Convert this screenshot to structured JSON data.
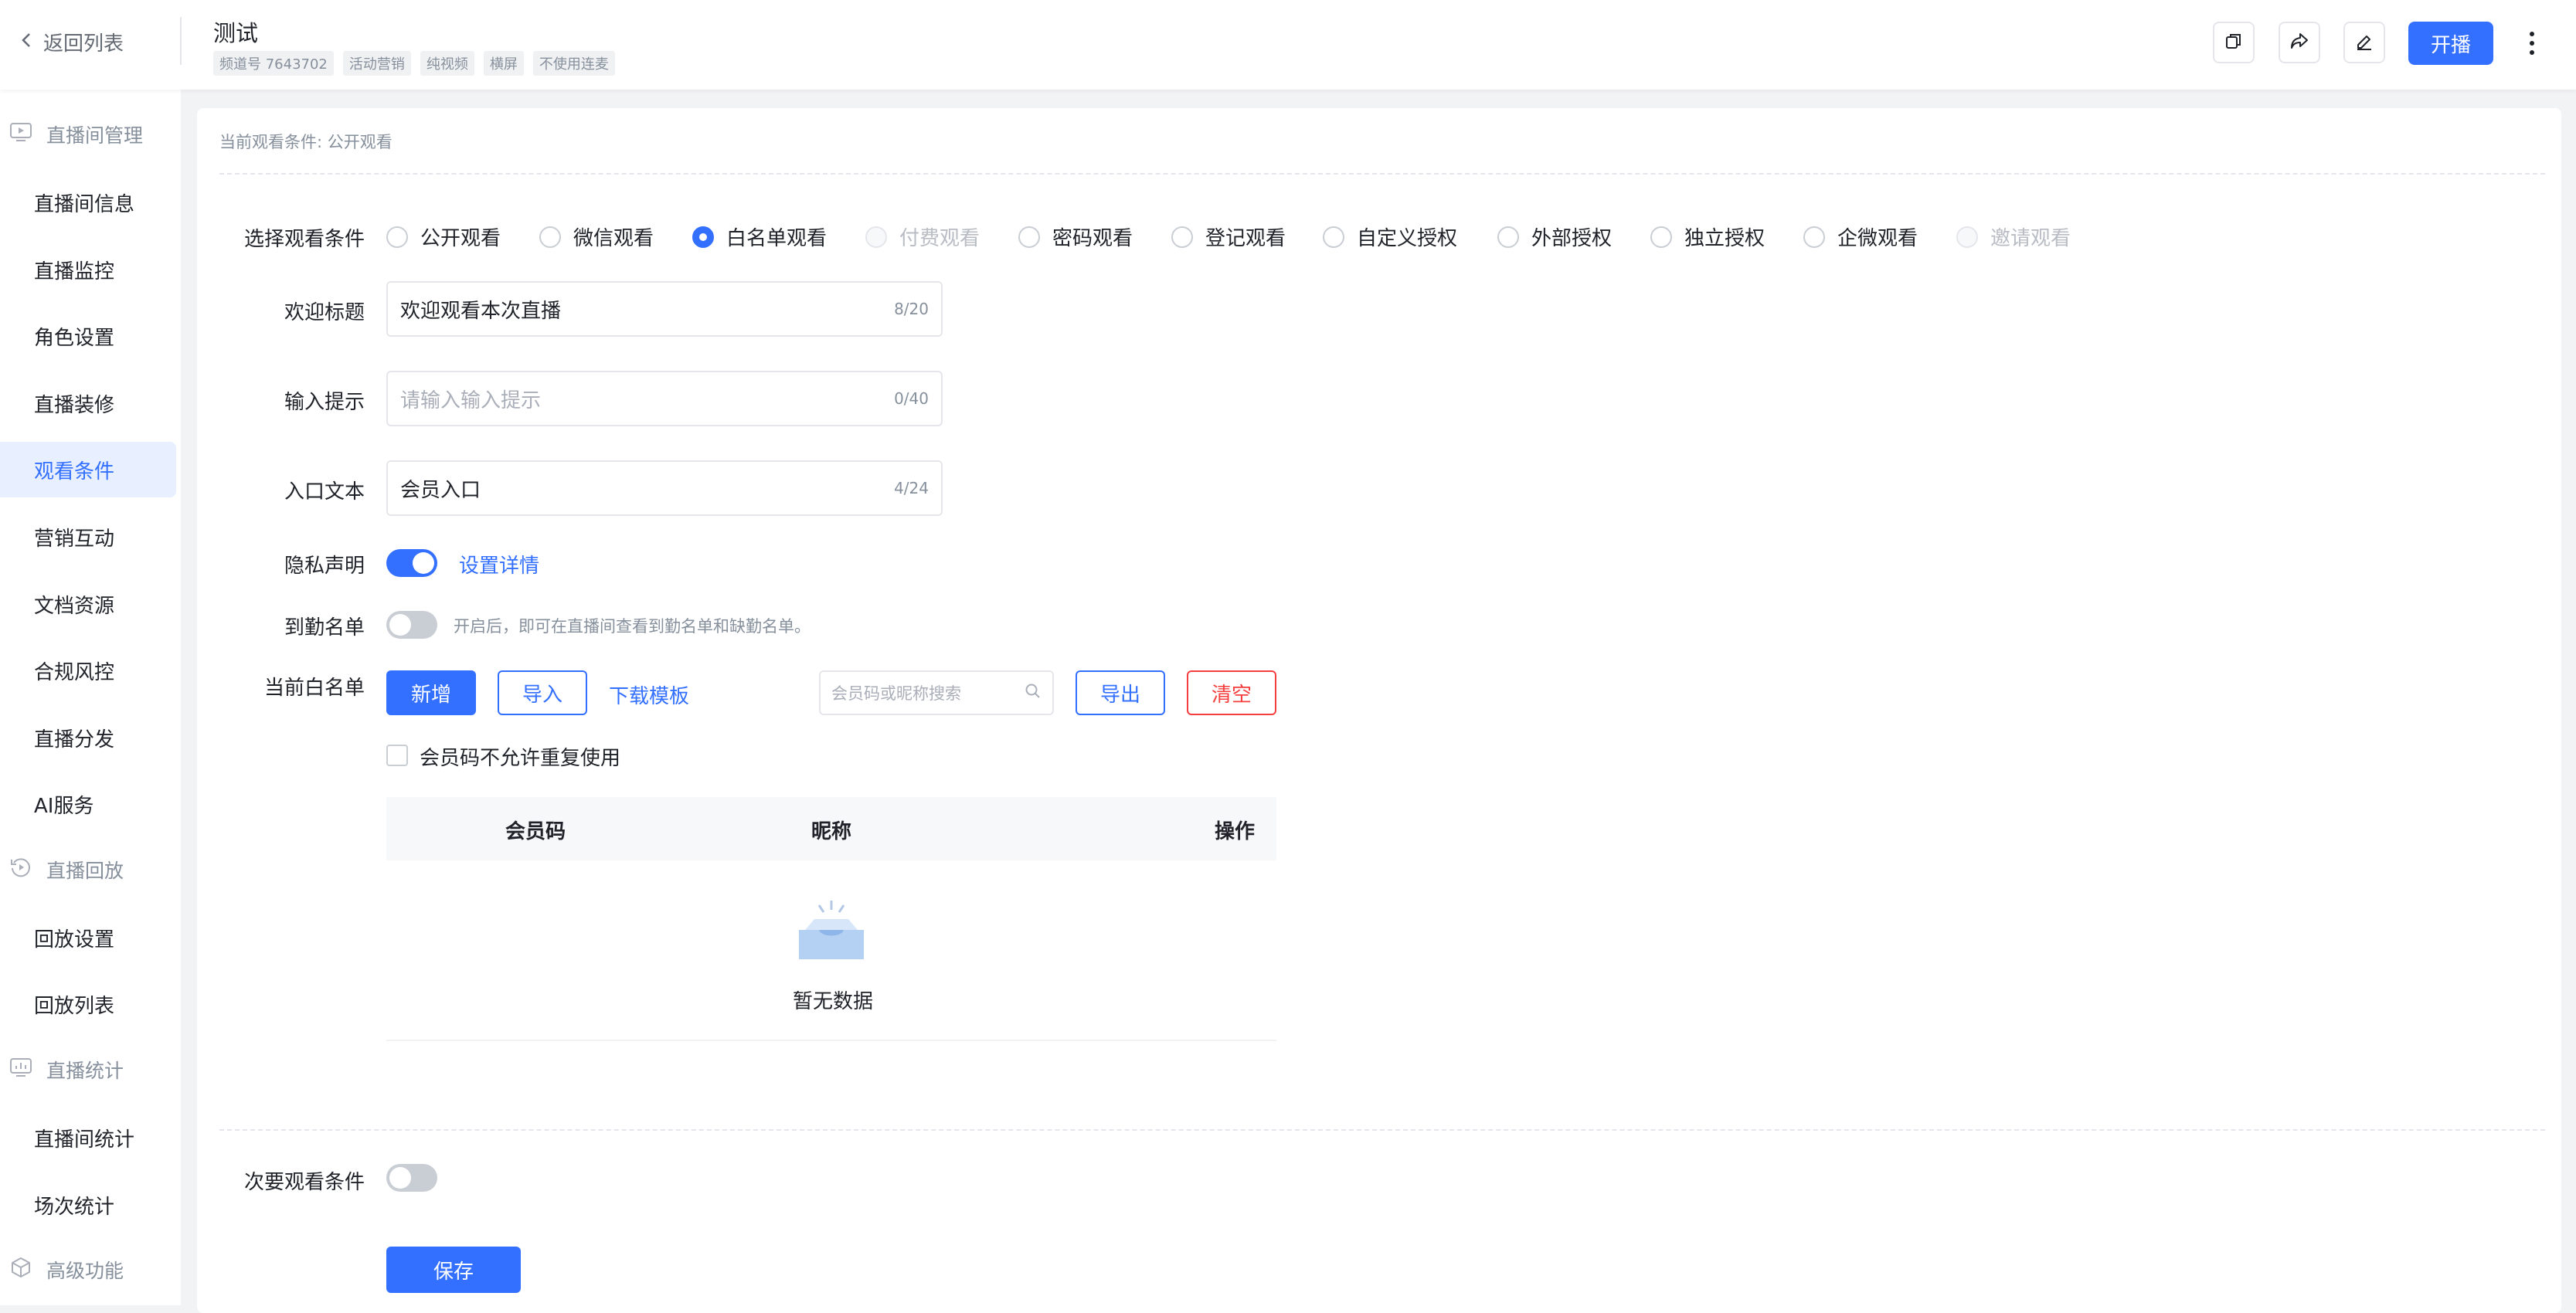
{
  "header": {
    "back_label": "返回列表",
    "title": "测试",
    "tags": [
      "频道号 7643702",
      "活动营销",
      "纯视频",
      "横屏",
      "不使用连麦"
    ],
    "start_button": "开播",
    "icons": [
      "copy-icon",
      "share-icon",
      "edit-icon",
      "more-vertical-icon"
    ]
  },
  "sidebar": {
    "groups": [
      {
        "label": "直播间管理",
        "icon": "monitor-play-icon"
      },
      {
        "label": "直播回放",
        "icon": "replay-icon"
      },
      {
        "label": "直播统计",
        "icon": "stats-icon"
      },
      {
        "label": "高级功能",
        "icon": "box-icon"
      }
    ],
    "items": [
      "直播间信息",
      "直播监控",
      "角色设置",
      "直播装修",
      "观看条件",
      "营销互动",
      "文档资源",
      "合规风控",
      "直播分发",
      "AI服务",
      "回放设置",
      "回放列表",
      "直播间统计",
      "场次统计"
    ],
    "active": "观看条件"
  },
  "main": {
    "current_condition": "当前观看条件: 公开观看",
    "select_label": "选择观看条件",
    "options": [
      {
        "label": "公开观看",
        "state": "normal"
      },
      {
        "label": "微信观看",
        "state": "normal"
      },
      {
        "label": "白名单观看",
        "state": "checked"
      },
      {
        "label": "付费观看",
        "state": "disabled"
      },
      {
        "label": "密码观看",
        "state": "normal"
      },
      {
        "label": "登记观看",
        "state": "normal"
      },
      {
        "label": "自定义授权",
        "state": "normal"
      },
      {
        "label": "外部授权",
        "state": "normal"
      },
      {
        "label": "独立授权",
        "state": "normal"
      },
      {
        "label": "企微观看",
        "state": "normal"
      },
      {
        "label": "邀请观看",
        "state": "disabled"
      }
    ],
    "welcome": {
      "label": "欢迎标题",
      "value": "欢迎观看本次直播",
      "count": "8/20"
    },
    "prompt": {
      "label": "输入提示",
      "placeholder": "请输入输入提示",
      "count": "0/40"
    },
    "entry": {
      "label": "入口文本",
      "value": "会员入口",
      "count": "4/24"
    },
    "privacy": {
      "label": "隐私声明",
      "enabled": true,
      "link": "设置详情"
    },
    "attendance": {
      "label": "到勤名单",
      "enabled": false,
      "hint": "开启后，即可在直播间查看到勤名单和缺勤名单。"
    },
    "whitelist": {
      "label": "当前白名单",
      "add": "新增",
      "import": "导入",
      "download": "下载模板",
      "search_placeholder": "会员码或昵称搜索",
      "export": "导出",
      "clear": "清空",
      "unique_checkbox": "会员码不允许重复使用",
      "columns": [
        "会员码",
        "昵称",
        "操作"
      ],
      "empty": "暂无数据"
    },
    "secondary": {
      "label": "次要观看条件",
      "enabled": false
    },
    "save": "保存"
  },
  "colors": {
    "primary": "#3370ff",
    "danger": "#f53f3f",
    "muted": "#86909c"
  }
}
